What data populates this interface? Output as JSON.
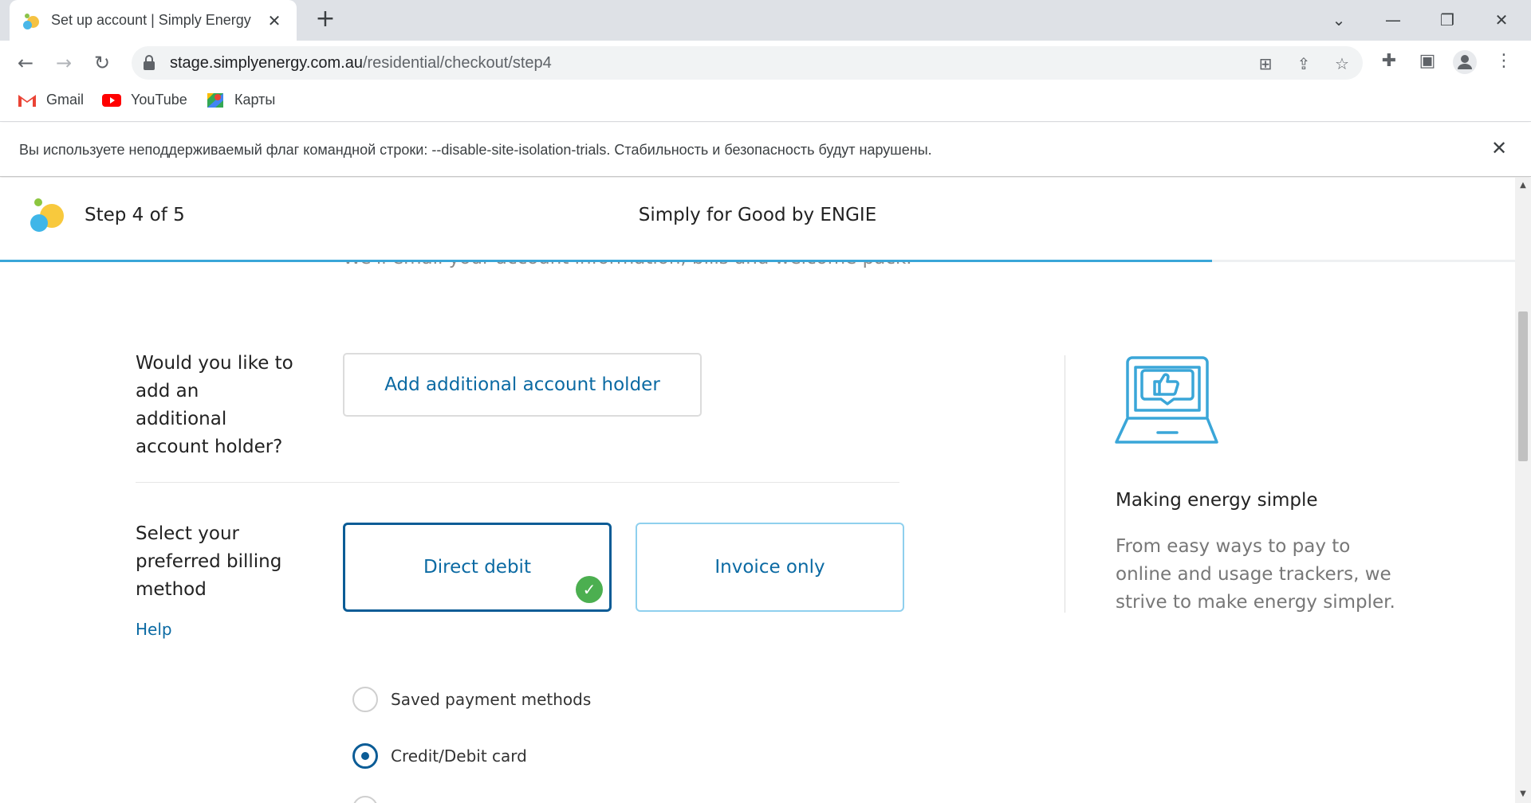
{
  "browser": {
    "tab_title": "Set up account | Simply Energy",
    "url_host": "stage.simplyenergy.com.au",
    "url_path": "/residential/checkout/step4",
    "bookmarks": [
      {
        "label": "Gmail",
        "icon": "gmail-icon"
      },
      {
        "label": "YouTube",
        "icon": "youtube-icon"
      },
      {
        "label": "Карты",
        "icon": "maps-icon"
      }
    ],
    "infobar_text": "Вы используете неподдерживаемый флаг командной строки: --disable-site-isolation-trials. Стабильность и безопасность будут нарушены."
  },
  "header": {
    "step_label": "Step 4 of 5",
    "brand_title": "Simply for Good by ENGIE",
    "progress_fraction": 0.8
  },
  "page": {
    "peek_text": "We'll email your account information, bills and welcome pack.",
    "additional_holder": {
      "question": "Would you like to add an additional account holder?",
      "button_label": "Add additional account holder"
    },
    "billing": {
      "question": "Select your preferred billing method",
      "help_label": "Help",
      "options": [
        {
          "label": "Direct debit",
          "selected": true
        },
        {
          "label": "Invoice only",
          "selected": false
        }
      ]
    },
    "payment_methods": [
      {
        "label": "Saved payment methods",
        "selected": false
      },
      {
        "label": "Credit/Debit card",
        "selected": true
      }
    ]
  },
  "promo": {
    "icon": "laptop-thumbs-up-icon",
    "title": "Making energy simple",
    "body": "From easy ways to pay to online and usage trackers, we strive to make energy simpler."
  },
  "colors": {
    "accent_blue": "#0b6aa3",
    "selected_border": "#0b5c96",
    "light_blue_border": "#8fd0ee",
    "progress": "#3aa6d8",
    "check_green": "#4caf50"
  }
}
